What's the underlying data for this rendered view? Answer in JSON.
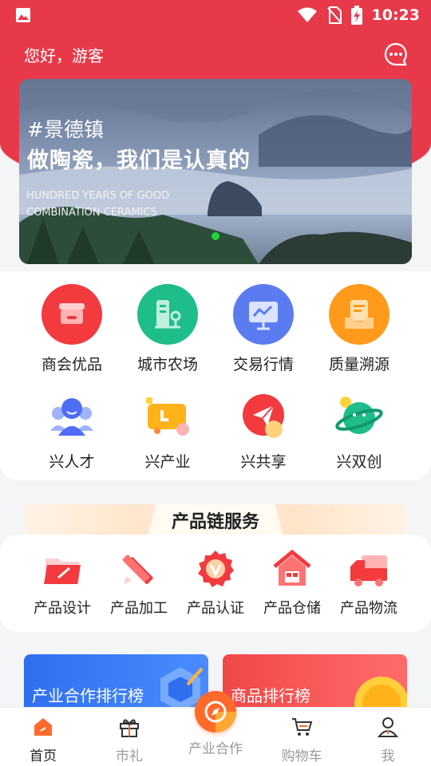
{
  "status_bar": {
    "time": "10:23"
  },
  "header": {
    "greeting": "您好，游客",
    "message_icon": "chat-bubble-icon"
  },
  "banner": {
    "tag": "#景德镇",
    "headline": "做陶瓷，我们是认真的",
    "subline1": "HUNDRED YEARS OF GOOD",
    "subline2": "COMBINATION CERAMICS"
  },
  "grid": {
    "row1": [
      {
        "label": "商会优品",
        "icon": "storefront-icon",
        "color": "#f23a3f"
      },
      {
        "label": "城市农场",
        "icon": "building-icon",
        "color": "#1fbd8a"
      },
      {
        "label": "交易行情",
        "icon": "chart-monitor-icon",
        "color": "#5b7cf0"
      },
      {
        "label": "质量溯源",
        "icon": "document-tray-icon",
        "color": "#ff9a1a"
      }
    ],
    "row2": [
      {
        "label": "兴人才",
        "icon": "people-icon"
      },
      {
        "label": "兴产业",
        "icon": "truck-icon"
      },
      {
        "label": "兴共享",
        "icon": "paper-plane-icon"
      },
      {
        "label": "兴双创",
        "icon": "planet-icon"
      }
    ]
  },
  "chain": {
    "title": "产品链服务",
    "items": [
      {
        "label": "产品设计",
        "icon": "folder-pen-icon"
      },
      {
        "label": "产品加工",
        "icon": "pencil-ruler-icon"
      },
      {
        "label": "产品认证",
        "icon": "badge-v-icon"
      },
      {
        "label": "产品仓储",
        "icon": "warehouse-icon"
      },
      {
        "label": "产品物流",
        "icon": "delivery-truck-icon"
      }
    ]
  },
  "rankings": {
    "left": {
      "label": "产业合作排行榜",
      "color": "#2f6ff0"
    },
    "right": {
      "label": "商品排行榜",
      "color": "#f04848"
    }
  },
  "tabbar": {
    "items": [
      {
        "label": "首页",
        "icon": "home-icon",
        "active": true
      },
      {
        "label": "市礼",
        "icon": "gift-icon"
      },
      {
        "label": "产业合作",
        "icon": "compass-icon"
      },
      {
        "label": "购物车",
        "icon": "cart-icon"
      },
      {
        "label": "我",
        "icon": "user-icon"
      }
    ]
  },
  "colors": {
    "brand_red": "#e8394a",
    "orange": "#ff6a2b"
  }
}
